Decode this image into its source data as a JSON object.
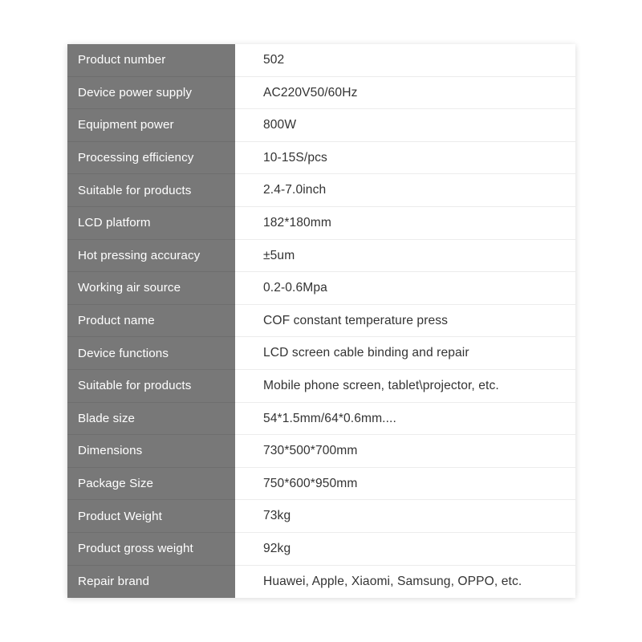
{
  "page": {
    "background_color": "#ffffff"
  },
  "spec_table": {
    "label_column_color": "#787878",
    "label_text_color": "#ffffff",
    "value_background_color": "#ffffff",
    "value_text_color": "#333333",
    "value_divider_color": "#ececec",
    "rows": [
      {
        "label": "Product number",
        "value": "502"
      },
      {
        "label": "Device power supply",
        "value": "AC220V50/60Hz"
      },
      {
        "label": "Equipment power",
        "value": "800W"
      },
      {
        "label": "Processing efficiency",
        "value": "10-15S/pcs"
      },
      {
        "label": "Suitable for products",
        "value": "2.4-7.0inch"
      },
      {
        "label": "LCD platform",
        "value": "182*180mm"
      },
      {
        "label": "Hot pressing accuracy",
        "value": "±5um"
      },
      {
        "label": "Working air source",
        "value": "0.2-0.6Mpa"
      },
      {
        "label": "Product name",
        "value": "COF constant temperature press"
      },
      {
        "label": "Device functions",
        "value": "LCD screen cable binding and repair"
      },
      {
        "label": "Suitable for products",
        "value": "Mobile phone screen, tablet\\projector, etc."
      },
      {
        "label": "Blade size",
        "value": "54*1.5mm/64*0.6mm...."
      },
      {
        "label": "Dimensions",
        "value": "730*500*700mm"
      },
      {
        "label": "Package Size",
        "value": "750*600*950mm"
      },
      {
        "label": "Product Weight",
        "value": "73kg"
      },
      {
        "label": "Product gross weight",
        "value": "92kg"
      },
      {
        "label": "Repair brand",
        "value": "Huawei, Apple, Xiaomi, Samsung, OPPO, etc."
      }
    ]
  }
}
